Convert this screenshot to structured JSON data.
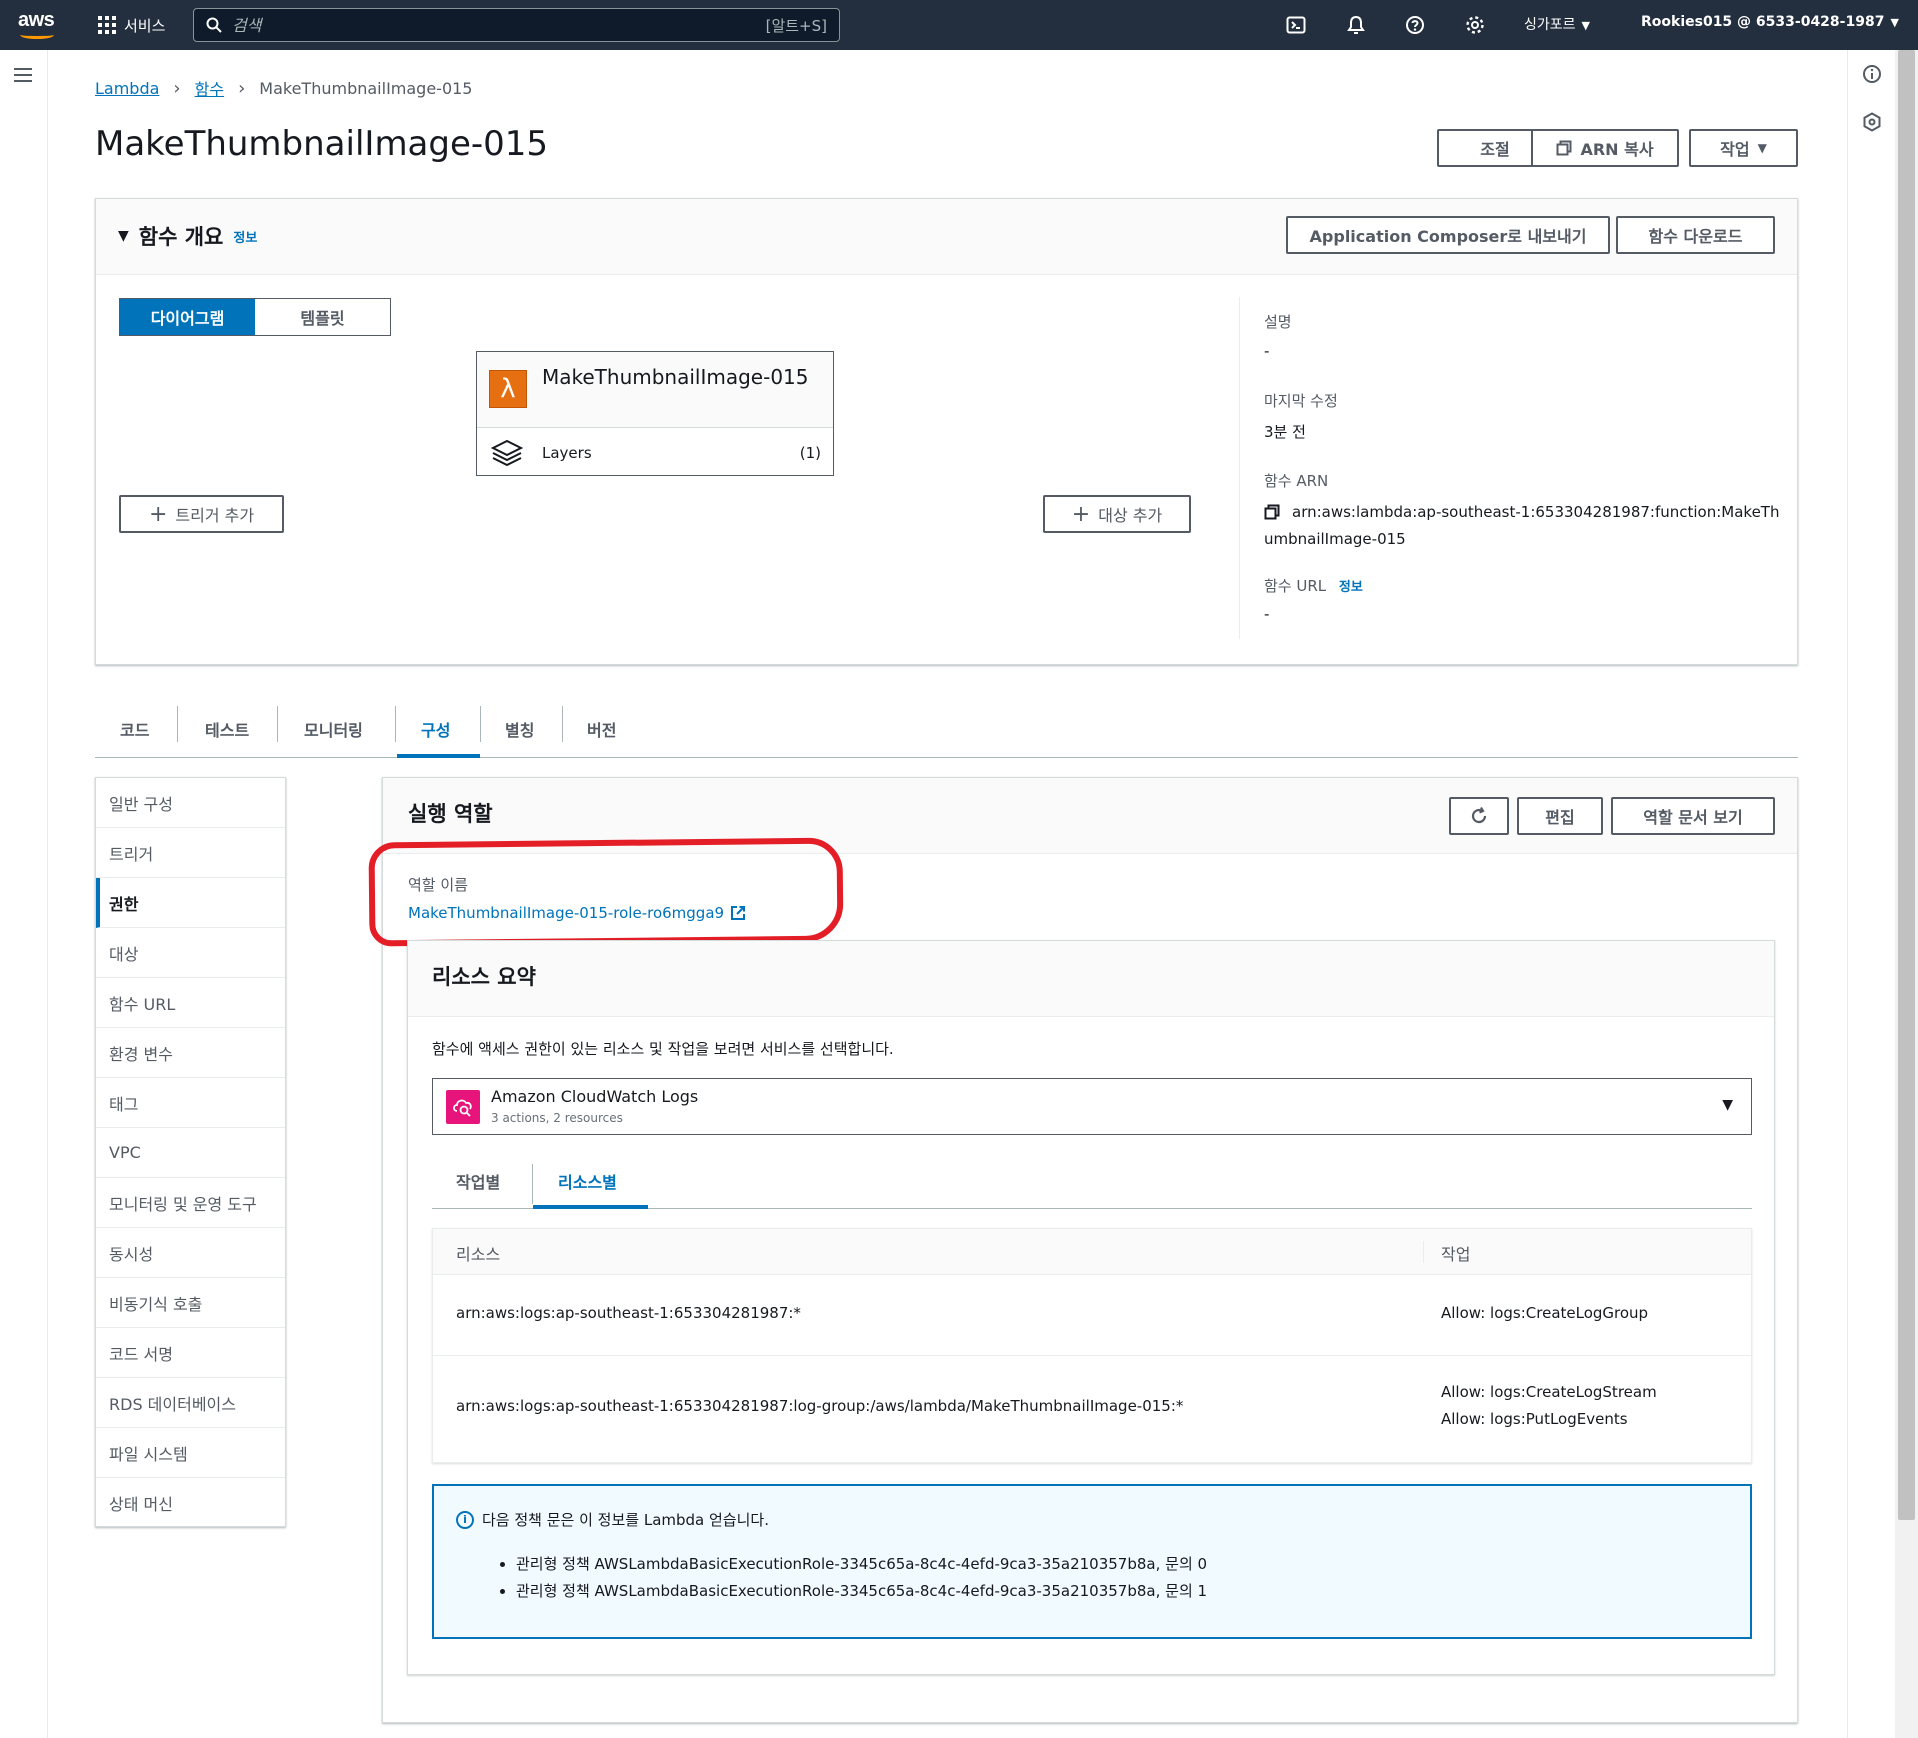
{
  "topnav": {
    "logo": "aws",
    "services_label": "서비스",
    "search_placeholder": "검색",
    "search_shortcut": "[알트+S]",
    "region": "싱가포르",
    "account": "Rookies015 @ 6533-0428-1987",
    "icons": [
      "cloudshell-icon",
      "bell-icon",
      "help-icon",
      "gear-icon"
    ]
  },
  "breadcrumb": {
    "items": [
      "Lambda",
      "함수"
    ],
    "current": "MakeThumbnailImage-015"
  },
  "page": {
    "title": "MakeThumbnailImage-015",
    "actions": {
      "throttle": "조절",
      "copy_arn": "ARN 복사",
      "actions": "작업"
    }
  },
  "overview": {
    "title": "함수 개요",
    "info": "정보",
    "export_button": "Application Composer로 내보내기",
    "download_button": "함수 다운로드",
    "view_toggle": {
      "diagram": "다이어그램",
      "template": "템플릿",
      "selected": "diagram"
    },
    "function_name": "MakeThumbnailImage-015",
    "layers_label": "Layers",
    "layers_count": "(1)",
    "add_trigger": "트리거 추가",
    "add_destination": "대상 추가",
    "meta": {
      "description_label": "설명",
      "description_value": "-",
      "last_modified_label": "마지막 수정",
      "last_modified_value": "3분 전",
      "arn_label": "함수 ARN",
      "arn_value": "arn:aws:lambda:ap-southeast-1:653304281987:function:MakeThumbnailImage-015",
      "url_label": "함수 URL",
      "url_info": "정보",
      "url_value": "-"
    }
  },
  "tabs": {
    "items": [
      "코드",
      "테스트",
      "모니터링",
      "구성",
      "별칭",
      "버전"
    ],
    "active": "구성"
  },
  "config_menu": {
    "items": [
      "일반 구성",
      "트리거",
      "권한",
      "대상",
      "함수 URL",
      "환경 변수",
      "태그",
      "VPC",
      "모니터링 및 운영 도구",
      "동시성",
      "비동기식 호출",
      "코드 서명",
      "RDS 데이터베이스",
      "파일 시스템",
      "상태 머신"
    ],
    "active": "권한"
  },
  "execution_role": {
    "title": "실행 역할",
    "edit_button": "편집",
    "view_doc_button": "역할 문서 보기",
    "role_name_label": "역할 이름",
    "role_name": "MakeThumbnailImage-015-role-ro6mgga9"
  },
  "resource_summary": {
    "title": "리소스 요약",
    "description": "함수에 액세스 권한이 있는 리소스 및 작업을 보려면 서비스를 선택합니다.",
    "service": {
      "name": "Amazon CloudWatch Logs",
      "subtitle": "3 actions, 2 resources"
    },
    "subtabs": [
      "작업별",
      "리소스별"
    ],
    "active_subtab": "리소스별",
    "columns": [
      "리소스",
      "작업"
    ],
    "rows": [
      {
        "resource": "arn:aws:logs:ap-southeast-1:653304281987:*",
        "actions": [
          "Allow: logs:CreateLogGroup"
        ]
      },
      {
        "resource": "arn:aws:logs:ap-southeast-1:653304281987:log-group:/aws/lambda/MakeThumbnailImage-015:*",
        "actions": [
          "Allow: logs:CreateLogStream",
          "Allow: logs:PutLogEvents"
        ]
      }
    ],
    "info": {
      "heading": "다음 정책 문은 이 정보를 Lambda 얻습니다.",
      "items": [
        "관리형 정책 AWSLambdaBasicExecutionRole-3345c65a-8c4c-4efd-9ca3-35a210357b8a, 문의 0",
        "관리형 정책 AWSLambdaBasicExecutionRole-3345c65a-8c4c-4efd-9ca3-35a210357b8a, 문의 1"
      ]
    }
  },
  "colors": {
    "nav_bg": "#232f3e",
    "accent": "#0073bb",
    "lambda_orange": "#e56f11",
    "cloudwatch_pink": "#e7157b",
    "annotation_red": "#e41e26"
  }
}
